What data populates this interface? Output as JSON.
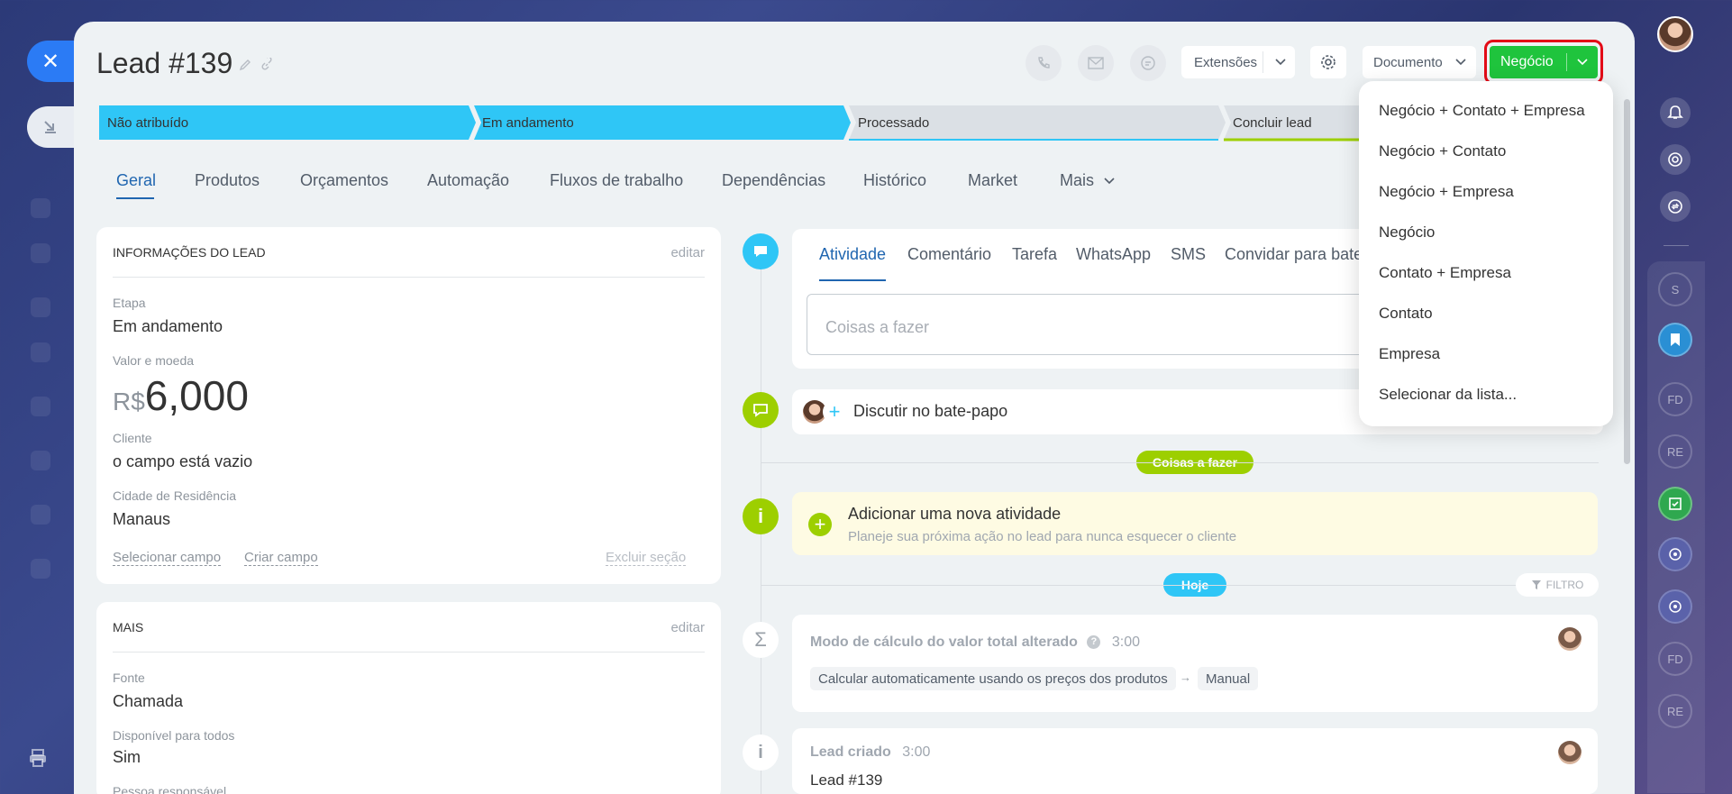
{
  "lead": {
    "title": "Lead #139"
  },
  "toolbar": {
    "extensions_label": "Extensões",
    "document_label": "Documento",
    "convert_label": "Negócio"
  },
  "stages": [
    {
      "label": "Não atribuído",
      "color": "#2fc6f6"
    },
    {
      "label": "Em andamento",
      "color": "#2fc6f6"
    },
    {
      "label": "Processado",
      "color": "#dbe0e5"
    },
    {
      "label": "Concluir lead",
      "color": "#dbe0e5"
    }
  ],
  "tabs": [
    "Geral",
    "Produtos",
    "Orçamentos",
    "Automação",
    "Fluxos de trabalho",
    "Dependências",
    "Histórico",
    "Market",
    "Mais"
  ],
  "info_card": {
    "heading": "INFORMAÇÕES DO LEAD",
    "edit": "editar",
    "stage_label": "Etapa",
    "stage_value": "Em andamento",
    "amount_label": "Valor e moeda",
    "currency": "R$",
    "amount": "6,000",
    "client_label": "Cliente",
    "client_value": "o campo está vazio",
    "city_label": "Cidade de Residência",
    "city_value": "Manaus",
    "select_field": "Selecionar campo",
    "create_field": "Criar campo",
    "delete_section": "Excluir seção"
  },
  "more_card": {
    "heading": "MAIS",
    "edit": "editar",
    "source_label": "Fonte",
    "source_value": "Chamada",
    "available_label": "Disponível para todos",
    "available_value": "Sim",
    "responsible_label": "Pessoa responsável"
  },
  "activity": {
    "tabs": [
      "Atividade",
      "Comentário",
      "Tarefa",
      "WhatsApp",
      "SMS",
      "Convidar para bate-papo"
    ],
    "placeholder": "Coisas a fazer"
  },
  "discuss": {
    "label": "Discutir no bate-papo"
  },
  "timeline": {
    "todo_pill": "Coisas a fazer",
    "add_title": "Adicionar uma nova atividade",
    "add_subtitle": "Planeje sua próxima ação no lead para nunca esquecer o cliente",
    "today_pill": "Hoje",
    "filter": "FILTRO",
    "events": [
      {
        "title": "Modo de cálculo do valor total alterado",
        "time": "3:00",
        "from": "Calcular automaticamente usando os preços dos produtos",
        "to": "Manual"
      },
      {
        "title": "Lead criado",
        "time": "3:00",
        "body": "Lead #139"
      }
    ]
  },
  "dropdown": {
    "items": [
      "Negócio + Contato + Empresa",
      "Negócio + Contato",
      "Negócio + Empresa",
      "Negócio",
      "Contato + Empresa",
      "Contato",
      "Empresa",
      "Selecionar da lista..."
    ]
  },
  "right_sidebar": {
    "chips": [
      "S",
      "FD",
      "RE",
      "FD",
      "RE"
    ]
  },
  "colors": {
    "accent_blue": "#2066b0",
    "stage_active": "#2fc6f6",
    "convert_green": "#1fc43d",
    "highlight_red": "#e30b17",
    "timeline_green": "#9dcf00"
  }
}
